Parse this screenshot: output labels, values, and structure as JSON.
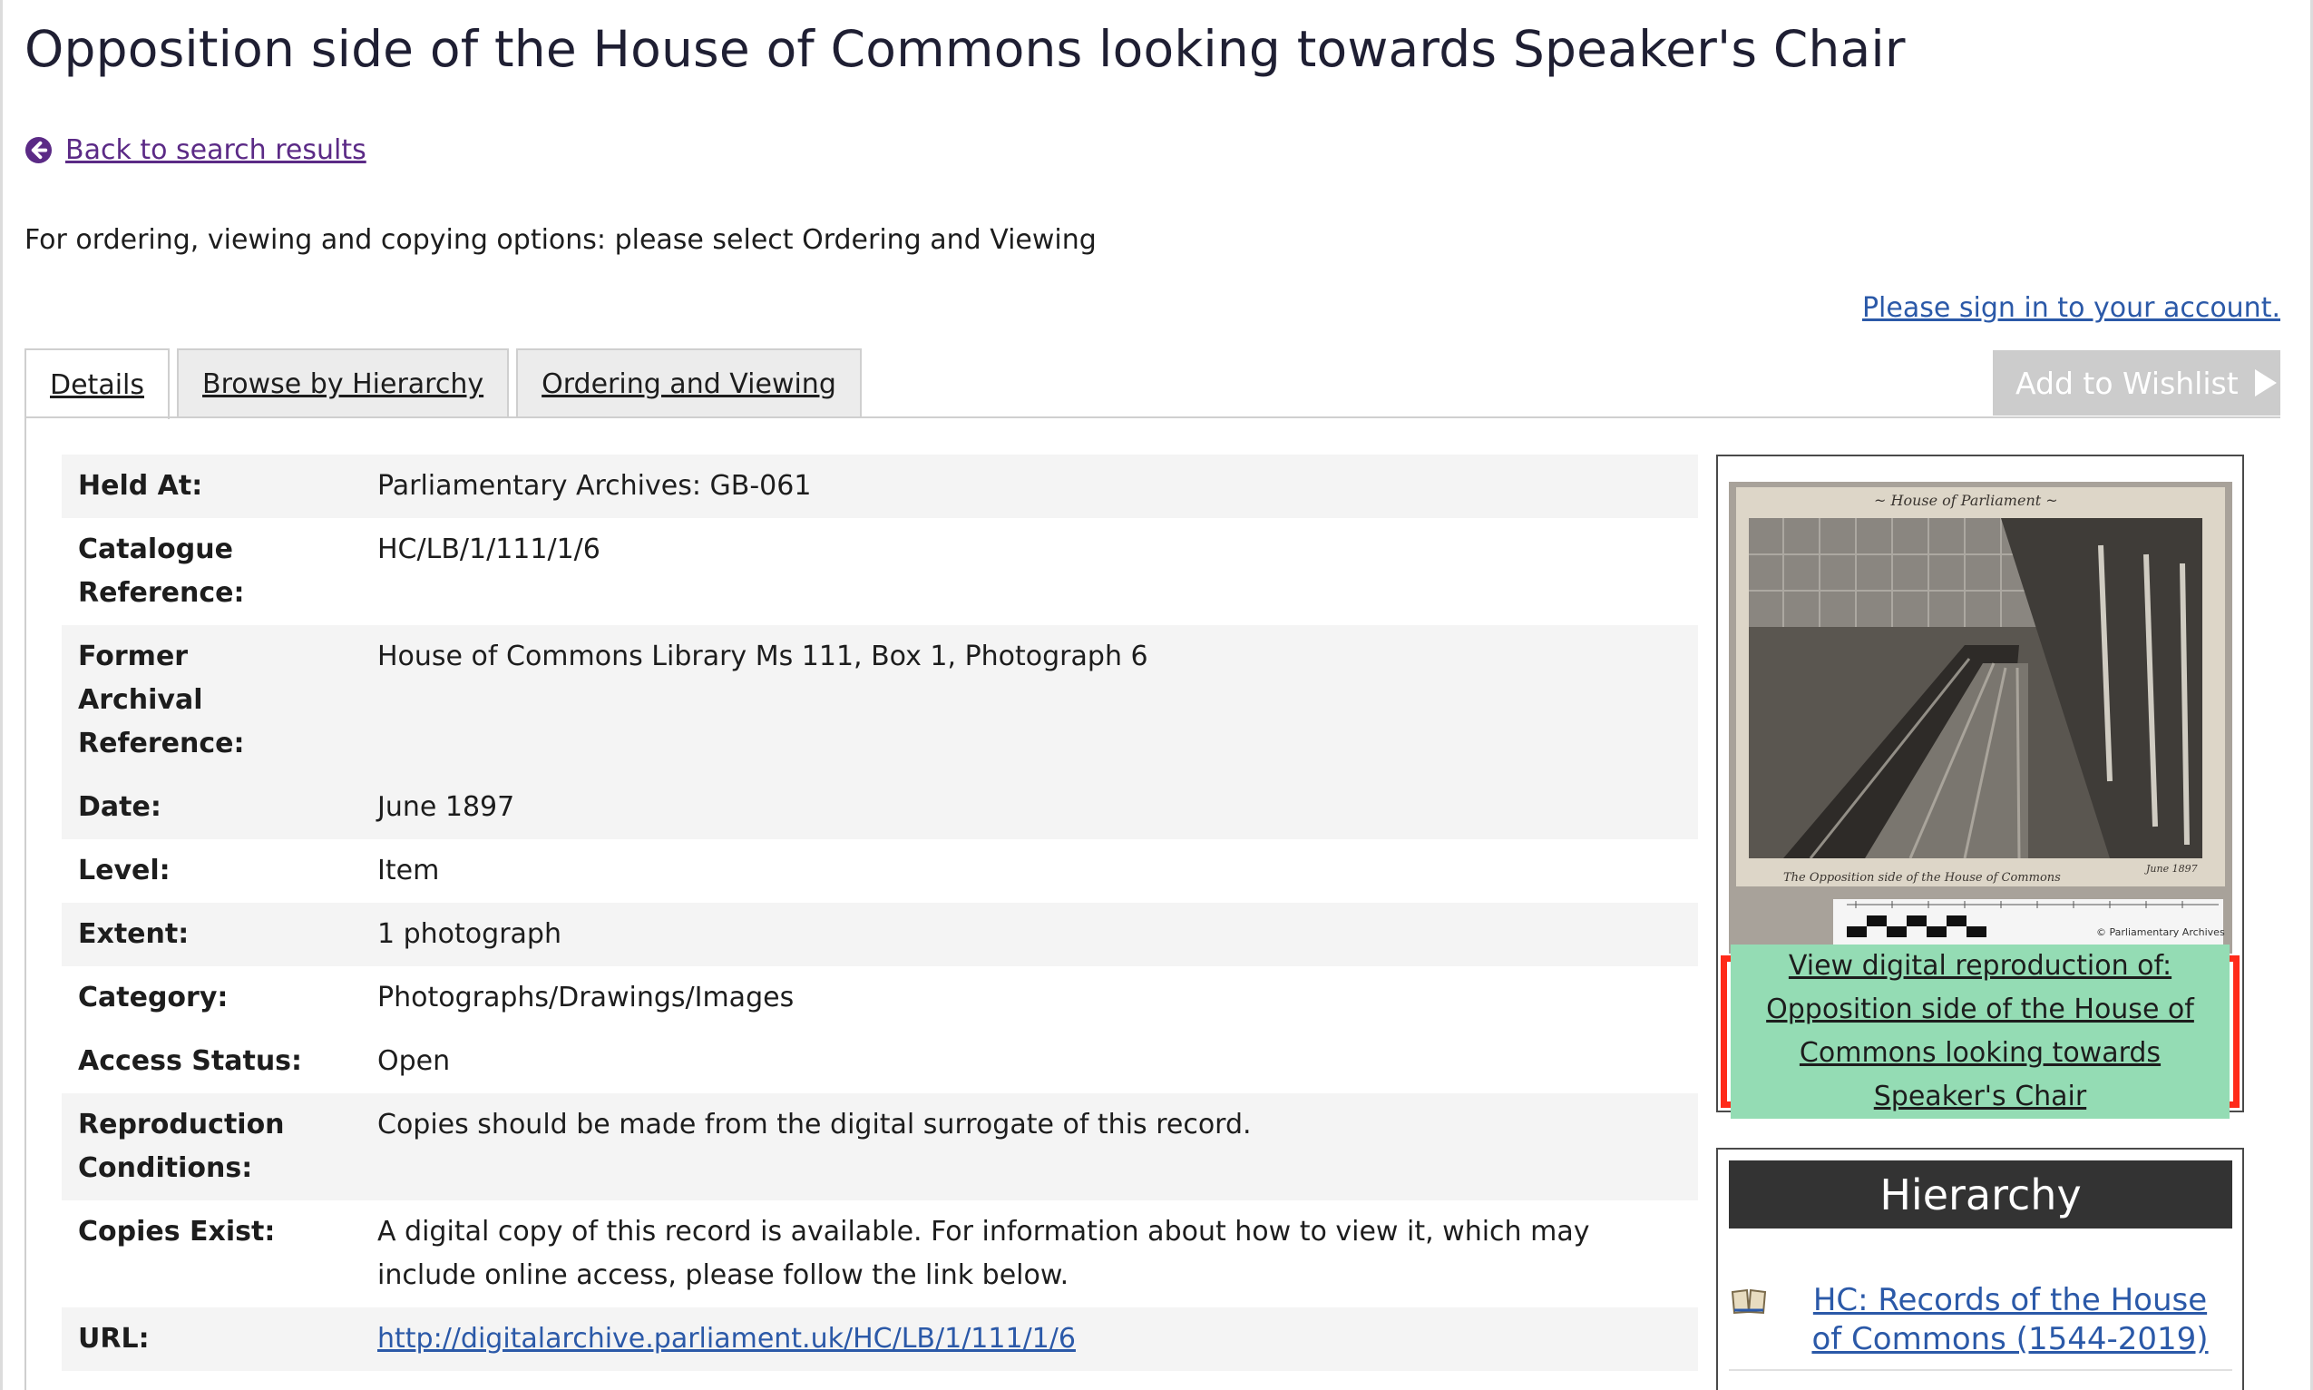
{
  "page": {
    "title": "Opposition side of the House of Commons looking towards Speaker's Chair",
    "back_link": "Back to search results",
    "intro_text": "For ordering, viewing and copying options: please select Ordering and Viewing",
    "signin_link": "Please sign in to your account."
  },
  "tabs": [
    {
      "label": "Details",
      "active": true
    },
    {
      "label": "Browse by Hierarchy",
      "active": false
    },
    {
      "label": "Ordering and Viewing",
      "active": false
    }
  ],
  "wishlist_button": "Add to Wishlist",
  "details": [
    {
      "label": "Held At:",
      "value": "Parliamentary Archives: GB-061"
    },
    {
      "label": "Catalogue Reference:",
      "value": "HC/LB/1/111/1/6"
    },
    {
      "label": "Former Archival Reference:",
      "value": "House of Commons Library Ms 111, Box 1, Photograph 6"
    },
    {
      "label": "Date:",
      "value": "June 1897"
    },
    {
      "label": "Level:",
      "value": "Item"
    },
    {
      "label": "Extent:",
      "value": "1 photograph"
    },
    {
      "label": "Category:",
      "value": "Photographs/Drawings/Images"
    },
    {
      "label": "Access Status:",
      "value": "Open"
    },
    {
      "label": "Reproduction Conditions:",
      "value": "Copies should be made from the digital surrogate of this record."
    },
    {
      "label": "Copies Exist:",
      "value": "A digital copy of this record is available. For information about how to view it, which may include online access, please follow the link below."
    },
    {
      "label": "URL:",
      "value": "http://digitalarchive.parliament.uk/HC/LB/1/111/1/6"
    }
  ],
  "image_panel": {
    "photo_caption_handwritten": "House of Parliament",
    "photo_copyright": "© Parliamentary Archives",
    "view_link": "View digital reproduction of: Opposition side of the House of Commons looking towards Speaker's Chair"
  },
  "hierarchy": {
    "heading": "Hierarchy",
    "items": [
      {
        "label": "HC: Records of the House of Commons (1544-2019)",
        "icon": "book-icon"
      }
    ]
  },
  "colors": {
    "title": "#1f1f33",
    "link": "#2b59a8",
    "back_link": "#5b2a86",
    "highlight": "#94dcb4",
    "highlight_border": "#ff2a1a",
    "hierarchy_header": "#333333",
    "wishlist_bg": "#cccccc"
  }
}
